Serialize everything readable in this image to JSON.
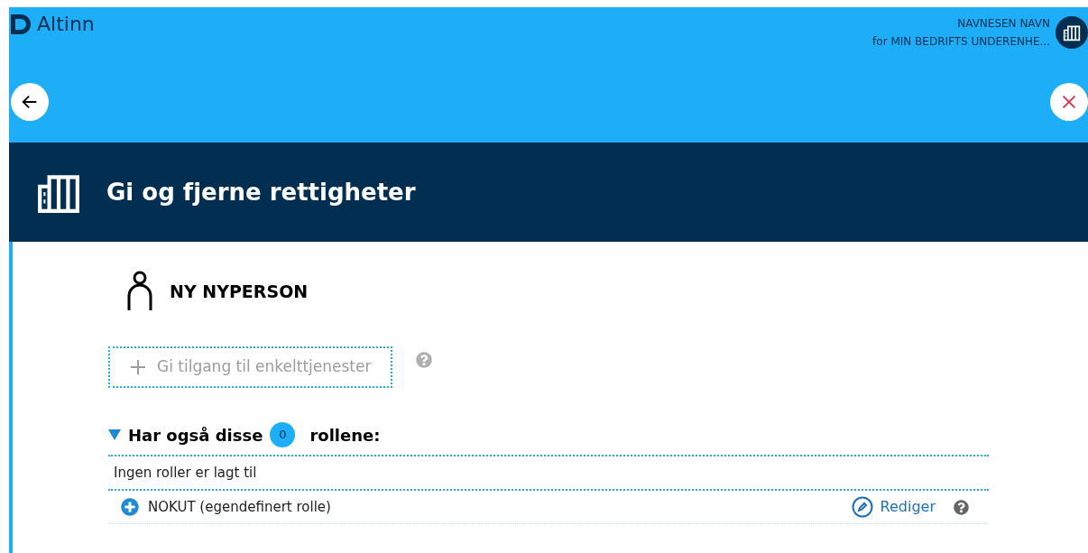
{
  "header": {
    "logo_text": "Altinn",
    "user_name": "NAVNESEN NAVN",
    "user_org": "for MIN BEDRIFTS UNDERENHE..."
  },
  "banner": {
    "title": "Gi og fjerne rettigheter"
  },
  "person": {
    "name": "NY NYPERSON"
  },
  "add_service_button": {
    "label": "Gi tilgang til enkelttjenester"
  },
  "roles_section": {
    "expanded": true,
    "title_before": "Har også disse",
    "count": "0",
    "title_after": "rollene:",
    "empty_text": "Ingen roller er lagt til"
  },
  "custom_roles": [
    {
      "name": "NOKUT (egendefinert rolle)",
      "edit_label": "Rediger"
    }
  ]
}
